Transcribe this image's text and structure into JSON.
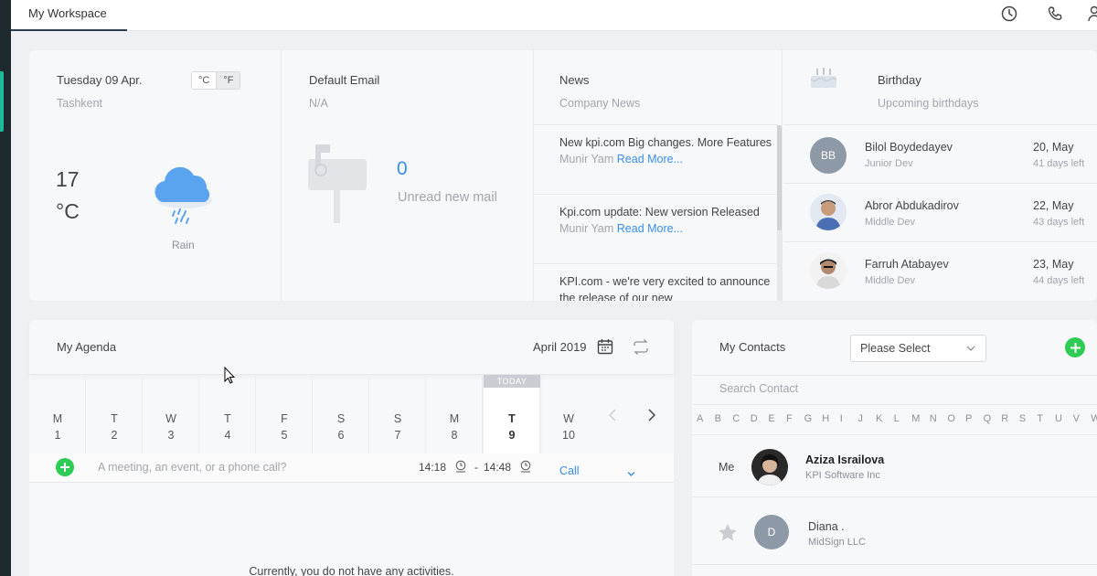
{
  "topbar": {
    "tab_label": "My Workspace"
  },
  "weather": {
    "date": "Tuesday 09 Apr.",
    "city": "Tashkent",
    "unit_c": "°C",
    "unit_f": "°F",
    "temperature": "17",
    "unit_display": "°C",
    "condition": "Rain"
  },
  "email": {
    "title": "Default Email",
    "address": "N/A",
    "count": "0",
    "count_label": "Unread new mail"
  },
  "news": {
    "title": "News",
    "subtitle": "Company News",
    "items": [
      {
        "title": "New kpi.com Big changes. More Features",
        "author": "Munir Yam",
        "more": "Read More..."
      },
      {
        "title": "Kpi.com update: New version Released",
        "author": "Munir Yam",
        "more": "Read More..."
      },
      {
        "title": "KPI.com - we're very excited to announce the release of our new",
        "author": "",
        "more": ""
      }
    ]
  },
  "birthday": {
    "title": "Birthday",
    "subtitle": "Upcoming birthdays",
    "items": [
      {
        "initials": "BB",
        "name": "Bilol Boydedayev",
        "role": "Junior Dev",
        "date": "20, May",
        "left": "41 days left"
      },
      {
        "initials": "",
        "name": "Abror Abdukadirov",
        "role": "Middle Dev",
        "date": "22, May",
        "left": "43 days left"
      },
      {
        "initials": "",
        "name": "Farruh Atabayev",
        "role": "Middle Dev",
        "date": "23, May",
        "left": "44 days left"
      }
    ]
  },
  "agenda": {
    "title": "My Agenda",
    "month": "April 2019",
    "today_label": "TODAY",
    "days": [
      {
        "l": "M",
        "n": "1"
      },
      {
        "l": "T",
        "n": "2"
      },
      {
        "l": "W",
        "n": "3"
      },
      {
        "l": "T",
        "n": "4"
      },
      {
        "l": "F",
        "n": "5"
      },
      {
        "l": "S",
        "n": "6"
      },
      {
        "l": "S",
        "n": "7"
      },
      {
        "l": "M",
        "n": "8"
      },
      {
        "l": "T",
        "n": "9"
      },
      {
        "l": "W",
        "n": "10"
      }
    ],
    "quick_placeholder": "A meeting, an event, or a phone call?",
    "time_start": "14:18",
    "time_sep": "-",
    "time_end": "14:48",
    "type": "Call",
    "empty": "Currently, you do not have any activities."
  },
  "contacts": {
    "title": "My Contacts",
    "select_value": "Please Select",
    "search_placeholder": "Search Contact",
    "letters": [
      "A",
      "B",
      "C",
      "D",
      "E",
      "F",
      "G",
      "H",
      "I",
      "J",
      "K",
      "L",
      "M",
      "N",
      "O",
      "P",
      "Q",
      "R",
      "S",
      "T",
      "U",
      "V",
      "W"
    ],
    "me_label": "Me",
    "items": [
      {
        "name": "Aziza Israilova",
        "company": "KPI Software Inc"
      },
      {
        "initial": "D",
        "name": "Diana .",
        "company": "MidSign LLC"
      }
    ]
  },
  "colors": {
    "accent": "#1abc9c",
    "link": "#3a8ee6",
    "add": "#2ecc55",
    "rain": "#5aa3ee"
  }
}
